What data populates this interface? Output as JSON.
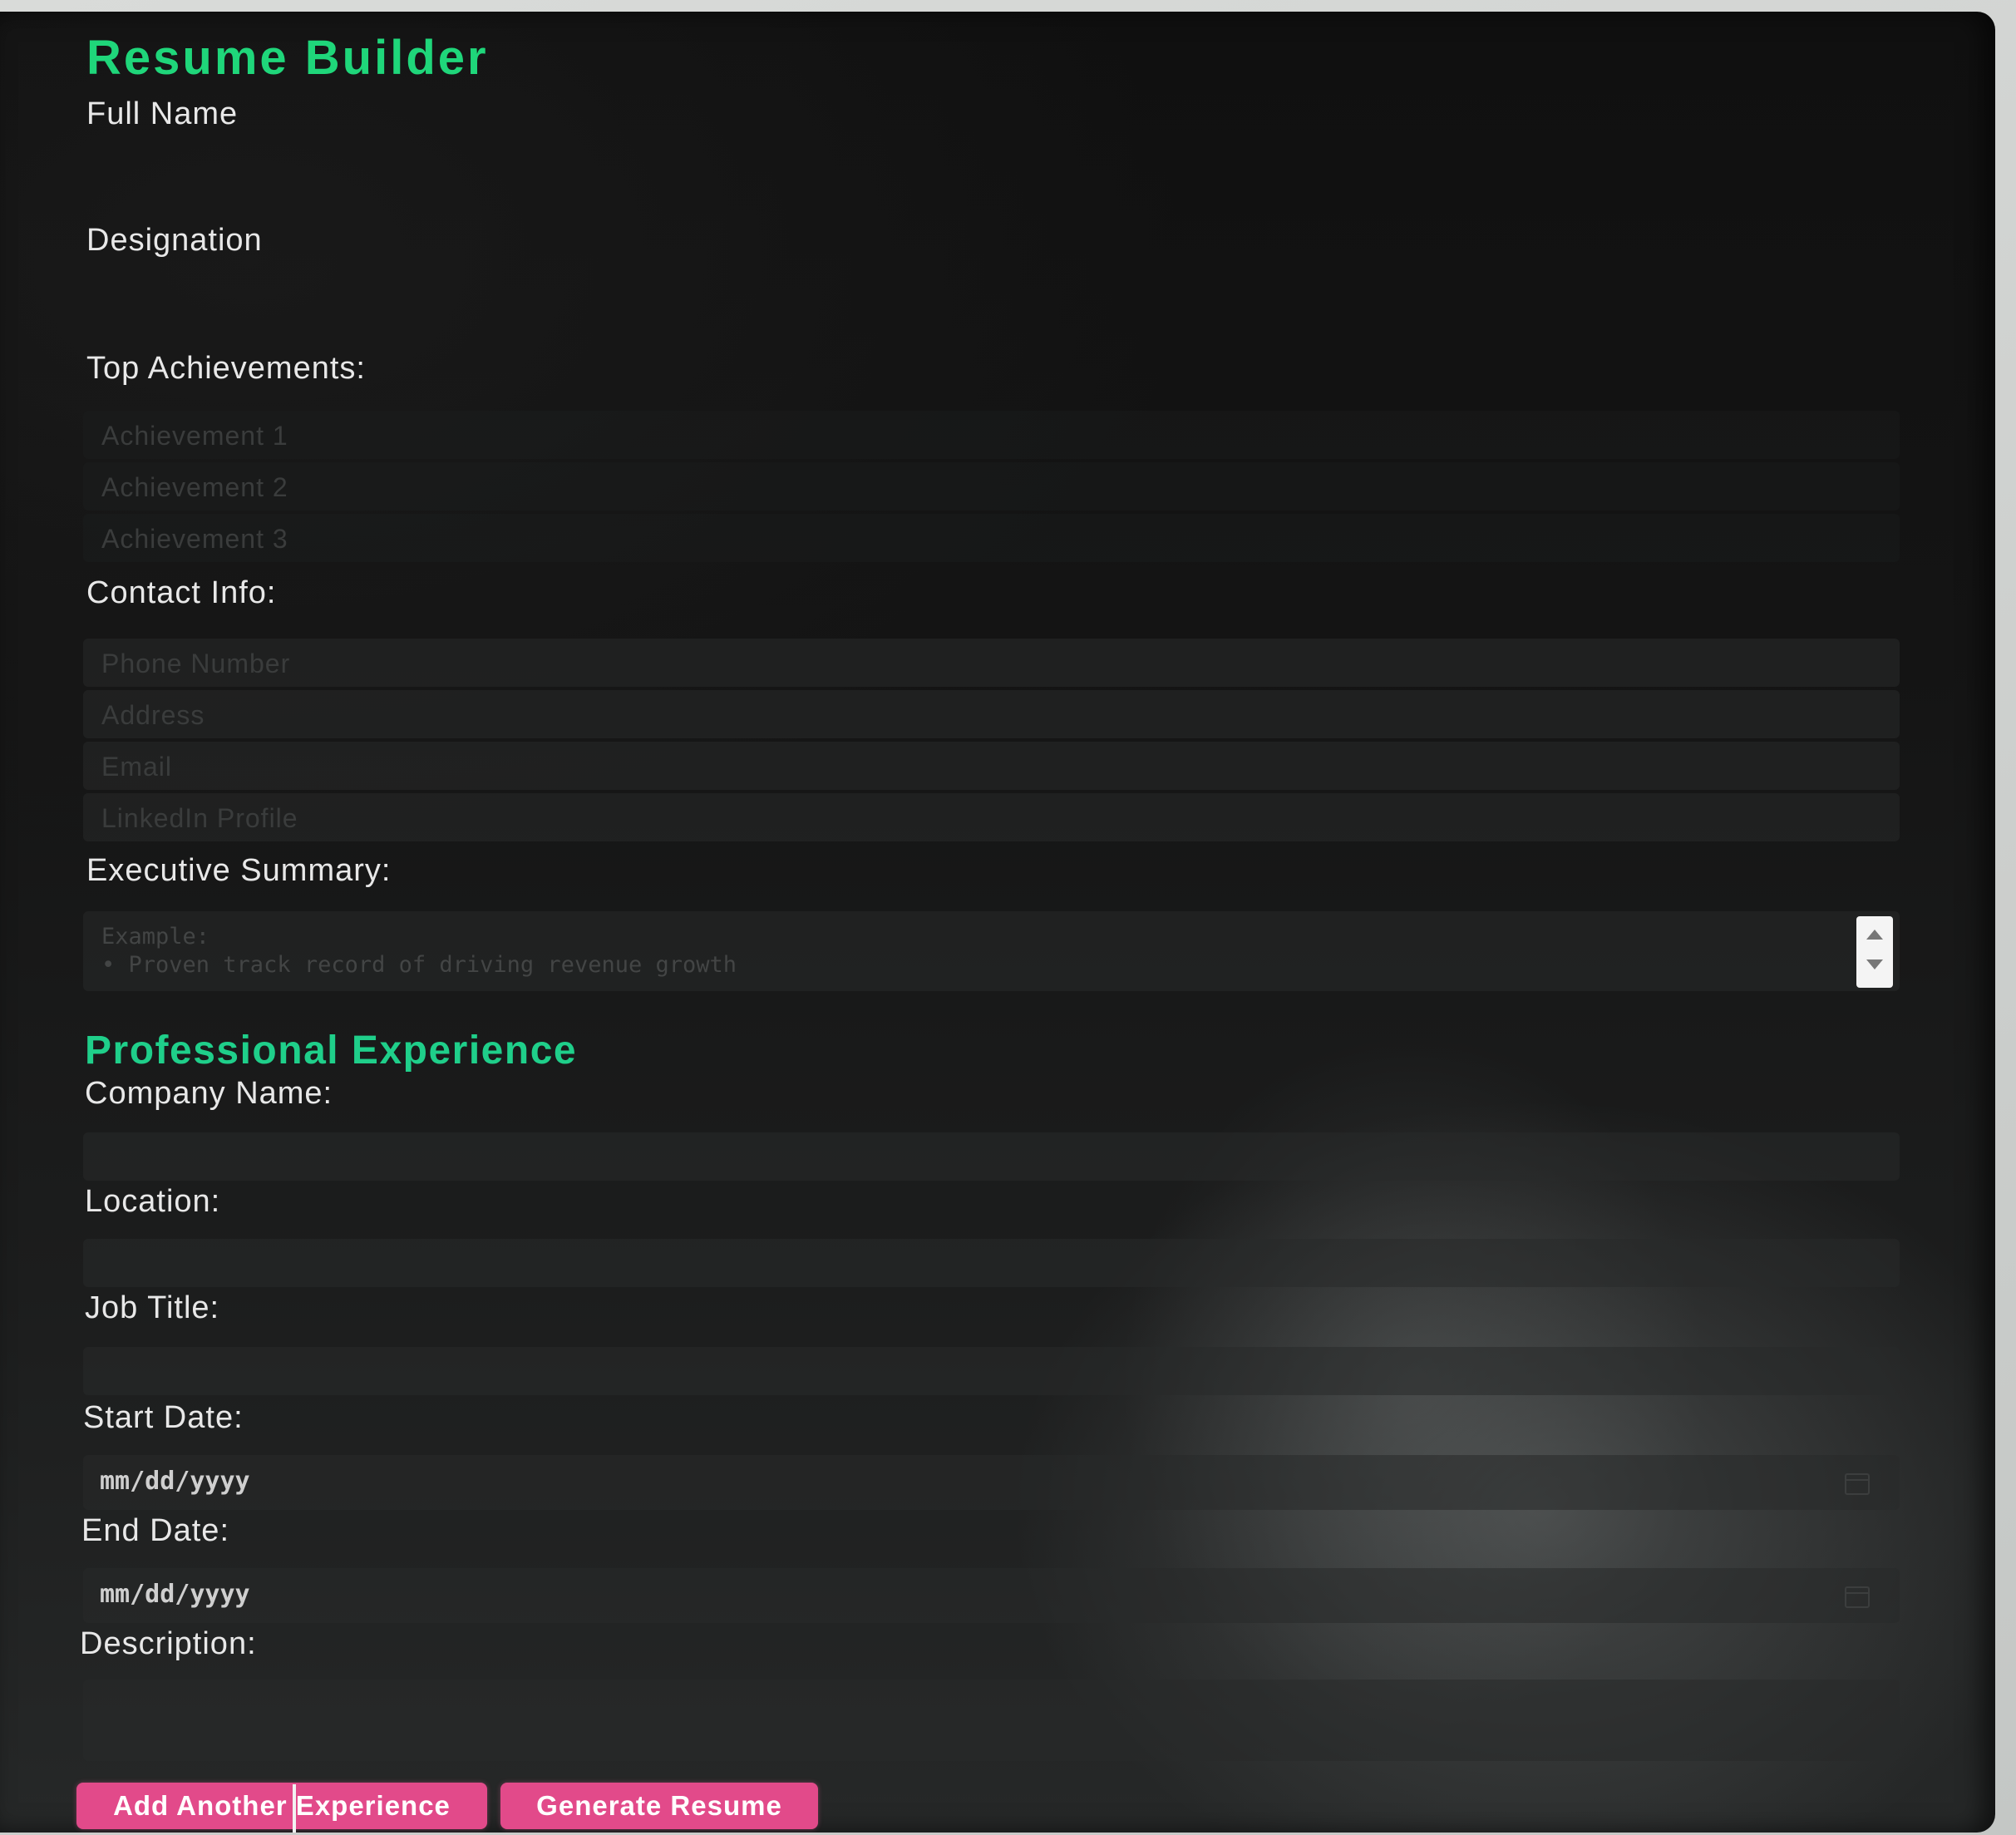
{
  "app": {
    "title": "Resume Builder"
  },
  "fields": {
    "full_name_label": "Full Name",
    "designation_label": "Designation",
    "achievements_label": "Top Achievements:",
    "achievements": [
      "Achievement 1",
      "Achievement 2",
      "Achievement 3"
    ],
    "contact_label": "Contact Info:",
    "contact_placeholders": [
      "Phone Number",
      "Address",
      "Email",
      "LinkedIn Profile"
    ],
    "summary_label": "Executive Summary:",
    "summary_placeholder": "Example:\n• Proven track record of driving revenue growth"
  },
  "experience": {
    "section_title": "Professional Experience",
    "company_label": "Company Name:",
    "location_label": "Location:",
    "job_title_label": "Job Title:",
    "start_date_label": "Start Date:",
    "start_date_placeholder": "mm/dd/yyyy",
    "end_date_label": "End Date:",
    "end_date_placeholder": "mm/dd/yyyy",
    "description_label": "Description:"
  },
  "buttons": {
    "add_experience": "Add Another Experience",
    "generate": "Generate Resume"
  },
  "colors": {
    "accent_green": "#1fd67a",
    "button_pink": "#e24a8a"
  }
}
